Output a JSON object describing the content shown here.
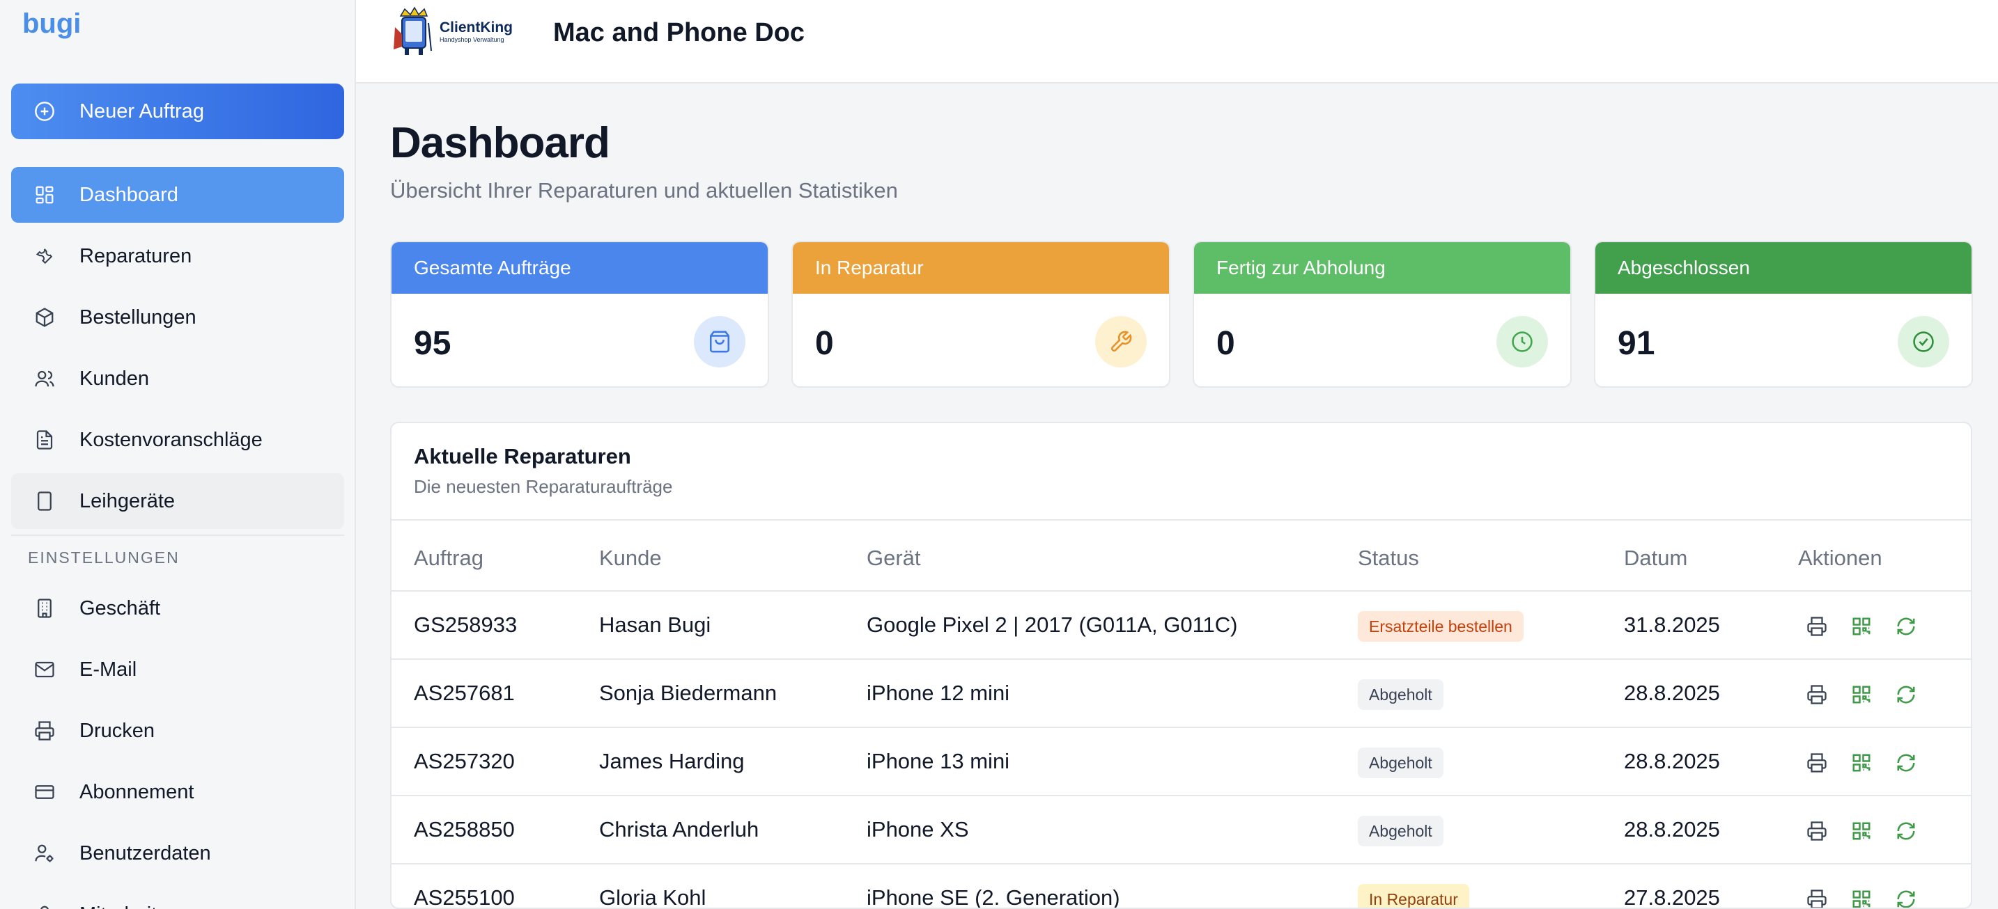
{
  "sidebar": {
    "brand": "bugi",
    "new_order": "Neuer Auftrag",
    "items": [
      {
        "label": "Dashboard"
      },
      {
        "label": "Reparaturen"
      },
      {
        "label": "Bestellungen"
      },
      {
        "label": "Kunden"
      },
      {
        "label": "Kostenvoranschläge"
      },
      {
        "label": "Leihgeräte"
      }
    ],
    "settings_label": "EINSTELLUNGEN",
    "settings_items": [
      {
        "label": "Geschäft"
      },
      {
        "label": "E-Mail"
      },
      {
        "label": "Drucken"
      },
      {
        "label": "Abonnement"
      },
      {
        "label": "Benutzerdaten"
      },
      {
        "label": "Mitarbeiter"
      }
    ]
  },
  "topbar": {
    "logo_name": "ClientKing",
    "logo_sub": "Handyshop Verwaltung",
    "shop_name": "Mac and Phone Doc"
  },
  "page": {
    "title": "Dashboard",
    "subtitle": "Übersicht Ihrer Reparaturen und aktuellen Statistiken"
  },
  "stats": [
    {
      "label": "Gesamte Aufträge",
      "value": "95",
      "color": "#4a86ec",
      "icon": "shopping-bag-icon"
    },
    {
      "label": "In Reparatur",
      "value": "0",
      "color": "#eba23b",
      "icon": "wrench-icon"
    },
    {
      "label": "Fertig zur Abholung",
      "value": "0",
      "color": "#5ebd67",
      "icon": "clock-icon"
    },
    {
      "label": "Abgeschlossen",
      "value": "91",
      "color": "#42a04d",
      "icon": "check-circle-icon"
    }
  ],
  "recent": {
    "title": "Aktuelle Reparaturen",
    "subtitle": "Die neuesten Reparaturaufträge",
    "columns": [
      "Auftrag",
      "Kunde",
      "Gerät",
      "Status",
      "Datum",
      "Aktionen"
    ],
    "rows": [
      {
        "order": "GS258933",
        "customer": "Hasan Bugi",
        "device": "Google Pixel 2 | 2017 (G011A, G011C)",
        "status": "Ersatzteile bestellen",
        "date": "31.8.2025"
      },
      {
        "order": "AS257681",
        "customer": "Sonja Biedermann",
        "device": "iPhone 12 mini",
        "status": "Abgeholt",
        "date": "28.8.2025"
      },
      {
        "order": "AS257320",
        "customer": "James Harding",
        "device": "iPhone 13 mini",
        "status": "Abgeholt",
        "date": "28.8.2025"
      },
      {
        "order": "AS258850",
        "customer": "Christa Anderluh",
        "device": "iPhone XS",
        "status": "Abgeholt",
        "date": "28.8.2025"
      },
      {
        "order": "AS255100",
        "customer": "Gloria Kohl",
        "device": "iPhone SE (2. Generation)",
        "status": "In Reparatur",
        "date": "27.8.2025"
      }
    ]
  }
}
